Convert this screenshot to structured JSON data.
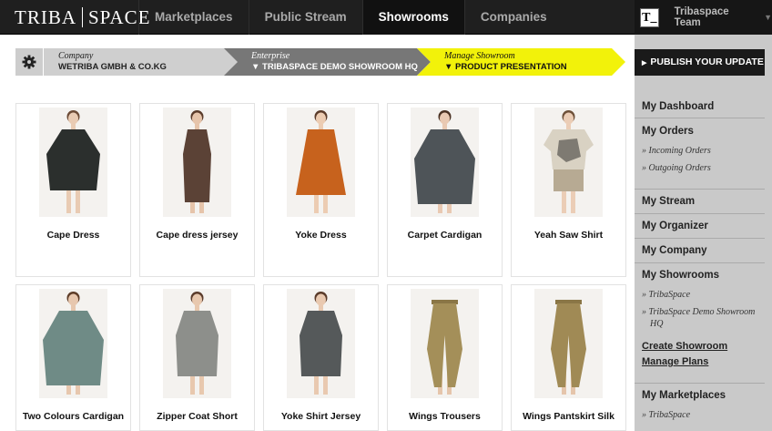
{
  "header": {
    "logo_left": "TRIBA",
    "logo_right": "SPACE",
    "nav": [
      "Marketplaces",
      "Public Stream",
      "Showrooms",
      "Companies"
    ],
    "active_nav": "Showrooms",
    "avatar_letter": "T_",
    "user_name": "Tribaspace Team",
    "user_caret": "▼"
  },
  "breadcrumb": [
    {
      "label": "Company",
      "value": "WETRIBA GMBH & CO.KG",
      "color": "#cfcfcf"
    },
    {
      "label": "Enterprise",
      "value": "▼ TRIBASPACE DEMO SHOWROOM HQ",
      "color": "#777777"
    },
    {
      "label": "Manage Showroom",
      "value": "▼ PRODUCT PRESENTATION",
      "color": "#f2f20a"
    }
  ],
  "sidebar": {
    "publish": "PUBLISH YOUR UPDATE",
    "dashboard": "My Dashboard",
    "orders": "My Orders",
    "incoming": "Incoming Orders",
    "outgoing": "Outgoing Orders",
    "stream": "My Stream",
    "organizer": "My Organizer",
    "company": "My Company",
    "showrooms": "My Showrooms",
    "showroom_1": "TribaSpace",
    "showroom_2": "TribaSpace Demo Showroom HQ",
    "create": "Create Showroom",
    "plans": "Manage Plans",
    "marketplaces": "My Marketplaces",
    "market_1": "TribaSpace"
  },
  "products": [
    {
      "name": "Cape Dress",
      "garment": "#2b2f2d",
      "skin": "#e9cbb3",
      "hair": "#6b4a35",
      "shape": "cape"
    },
    {
      "name": "Cape dress jersey",
      "garment": "#5b4236",
      "skin": "#e6c4aa",
      "hair": "#5a3b2a",
      "shape": "long"
    },
    {
      "name": "Yoke Dress",
      "garment": "#c7621d",
      "skin": "#ecccb2",
      "hair": "#5a3b2a",
      "shape": "dress"
    },
    {
      "name": "Carpet Cardigan",
      "garment": "#4e5458",
      "skin": "#e9c9b2",
      "hair": "#4a3122",
      "shape": "wide"
    },
    {
      "name": "Yeah Saw Shirt",
      "garment": "#d9d2c3",
      "skin": "#ebcdb6",
      "hair": "#6d5038",
      "shape": "shirt"
    },
    {
      "name": "Two Colours Cardigan",
      "garment": "#6f8b86",
      "skin": "#e7c7ae",
      "hair": "#5d3c27",
      "shape": "wide"
    },
    {
      "name": "Zipper Coat Short",
      "garment": "#8d8f8b",
      "skin": "#e8c8ae",
      "hair": "#5a3b2a",
      "shape": "coat"
    },
    {
      "name": "Yoke Shirt Jersey",
      "garment": "#55595a",
      "skin": "#e9c9b0",
      "hair": "#5a3b2a",
      "shape": "coat"
    },
    {
      "name": "Wings Trousers",
      "garment": "#a48f59",
      "skin": "#e5c5ab",
      "hair": "#5a3b2a",
      "shape": "trousers"
    },
    {
      "name": "Wings Pantskirt Silk",
      "garment": "#a08a55",
      "skin": "#e5c5ab",
      "hair": "#5a3b2a",
      "shape": "trousers"
    }
  ]
}
